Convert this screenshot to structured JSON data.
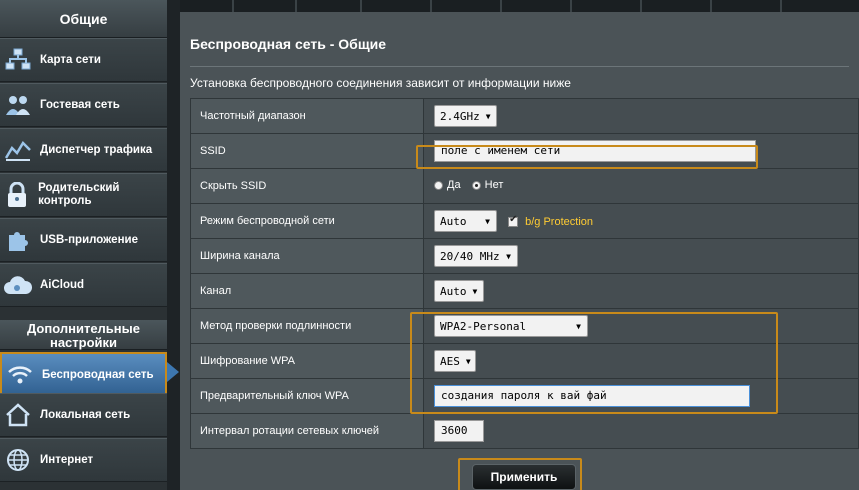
{
  "sidebar": {
    "general_header": "Общие",
    "items": [
      {
        "label": "Карта сети",
        "icon": "network-map-icon"
      },
      {
        "label": "Гостевая сеть",
        "icon": "guest-network-icon"
      },
      {
        "label": "Диспетчер трафика",
        "icon": "traffic-manager-icon"
      },
      {
        "label": "Родительский контроль",
        "icon": "parental-control-icon"
      },
      {
        "label": "USB-приложение",
        "icon": "usb-app-icon"
      },
      {
        "label": "AiCloud",
        "icon": "aicloud-icon"
      }
    ],
    "advanced_header": "Дополнительные настройки",
    "advanced_items": [
      {
        "label": "Беспроводная сеть",
        "icon": "wireless-icon",
        "active": true
      },
      {
        "label": "Локальная сеть",
        "icon": "lan-icon"
      },
      {
        "label": "Интернет",
        "icon": "internet-icon"
      }
    ]
  },
  "main": {
    "title": "Беспроводная сеть - Общие",
    "description": "Установка беспроводного соединения зависит от информации ниже",
    "fields": {
      "band": {
        "label": "Частотный диапазон",
        "value": "2.4GHz"
      },
      "ssid": {
        "label": "SSID",
        "value": "поле с именем сети"
      },
      "hide_ssid": {
        "label": "Скрыть SSID",
        "yes": "Да",
        "no": "Нет",
        "selected": "Нет"
      },
      "wireless_mode": {
        "label": "Режим беспроводной сети",
        "value": "Auto",
        "checkbox_label": "b/g Protection",
        "checked": true
      },
      "channel_width": {
        "label": "Ширина канала",
        "value": "20/40 MHz"
      },
      "channel": {
        "label": "Канал",
        "value": "Auto"
      },
      "auth_method": {
        "label": "Метод проверки подлинности",
        "value": "WPA2-Personal"
      },
      "wpa_encryption": {
        "label": "Шифрование WPA",
        "value": "AES"
      },
      "wpa_key": {
        "label": "Предварительный ключ WPA",
        "value": "создания пароля к вай фай"
      },
      "key_rotation": {
        "label": "Интервал ротации сетевых ключей",
        "value": "3600"
      }
    },
    "apply_label": "Применить"
  },
  "colors": {
    "highlight": "#c88a1a",
    "active_item": "#3d77b0",
    "protection_label": "#ffcc33"
  }
}
